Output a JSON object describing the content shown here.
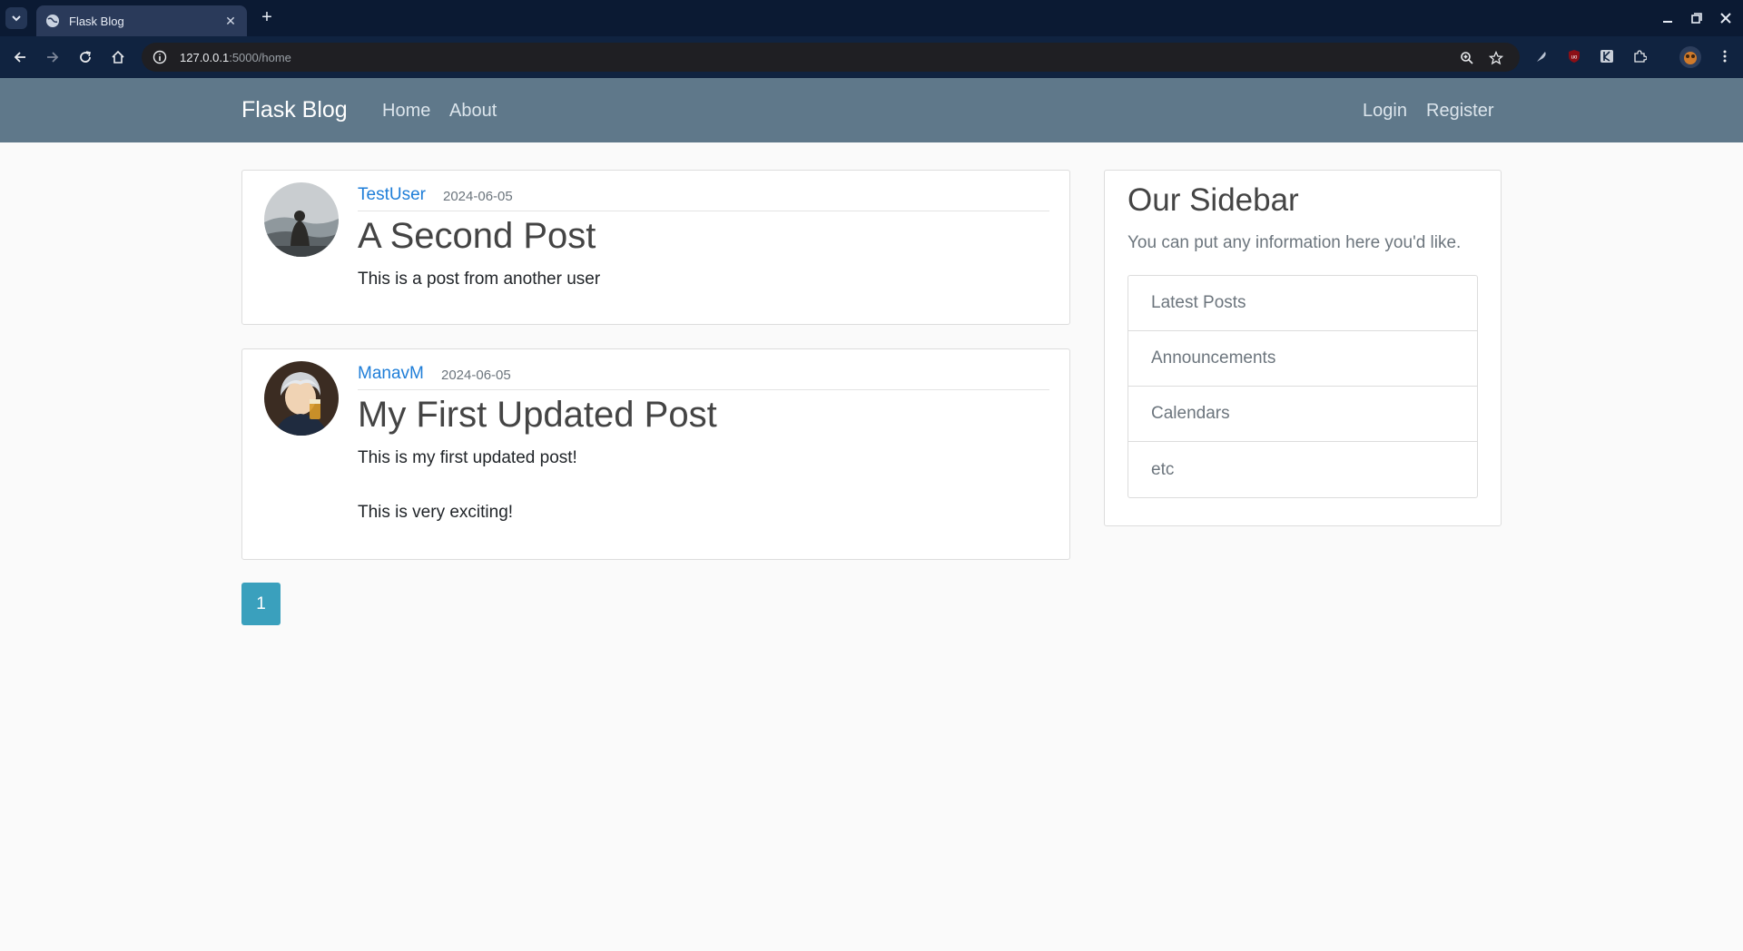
{
  "browser": {
    "tab_title": "Flask Blog",
    "url_host": "127.0.0.1",
    "url_path": ":5000/home"
  },
  "navbar": {
    "brand": "Flask Blog",
    "links": [
      {
        "label": "Home"
      },
      {
        "label": "About"
      }
    ],
    "auth_links": [
      {
        "label": "Login"
      },
      {
        "label": "Register"
      }
    ]
  },
  "posts": [
    {
      "author": "TestUser",
      "date": "2024-06-05",
      "title": "A Second Post",
      "body": [
        "This is a post from another user"
      ]
    },
    {
      "author": "ManavM",
      "date": "2024-06-05",
      "title": "My First Updated Post",
      "body": [
        "This is my first updated post!",
        "This is very exciting!"
      ]
    }
  ],
  "pagination": {
    "pages": [
      "1"
    ],
    "current": "1",
    "active_color": "#3aa0bd"
  },
  "sidebar": {
    "title": "Our Sidebar",
    "subtitle": "You can put any information here you'd like.",
    "items": [
      {
        "label": "Latest Posts"
      },
      {
        "label": "Announcements"
      },
      {
        "label": "Calendars"
      },
      {
        "label": "etc"
      }
    ]
  },
  "colors": {
    "navbar_bg": "#5f788a",
    "link": "#1f7ed8",
    "page_bg": "#fafafa"
  }
}
